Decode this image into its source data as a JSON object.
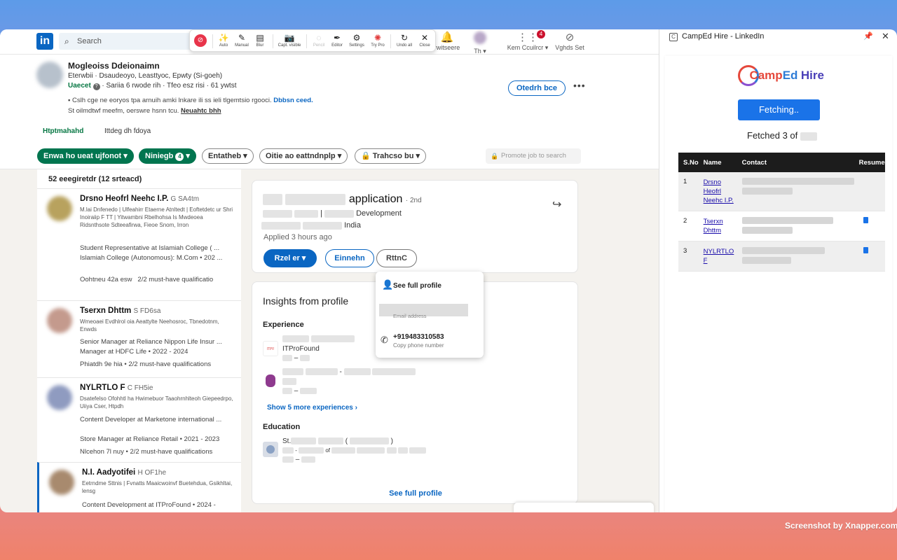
{
  "topbar": {
    "logo_text": "in",
    "search_placeholder": "Search",
    "nav": [
      {
        "icon": "bell-icon",
        "label": "rwitseere"
      },
      {
        "icon": "avatar",
        "label": "Th ▾"
      },
      {
        "icon": "grid-icon",
        "label": "Kem Ccuilrcr ▾",
        "badge": "4"
      },
      {
        "icon": "compass-icon",
        "label": "Vghds Set"
      }
    ]
  },
  "snap_toolbar": {
    "buttons": [
      {
        "label": "Auto",
        "glyph": "✨"
      },
      {
        "label": "Manual",
        "glyph": "✎"
      },
      {
        "label": "Blur",
        "glyph": "▤"
      },
      {
        "label": "Capt. visible",
        "glyph": "📷"
      },
      {
        "label": "Pencil",
        "glyph": "◌",
        "disabled": true
      },
      {
        "label": "Editor",
        "glyph": "✒"
      },
      {
        "label": "Settings",
        "glyph": "⚙"
      },
      {
        "label": "Try Pro",
        "glyph": "✺"
      },
      {
        "label": "Undo all",
        "glyph": "↻"
      },
      {
        "label": "Close",
        "glyph": "✕"
      }
    ]
  },
  "candidate": {
    "name": "Mogleoiss Ddeionaimn",
    "subtitle": "Eterwbii · Dsaudeoyo, Leasttyoc, Epwty (Si-goeh)",
    "status_green": "Uaecet",
    "status_rest": " · Sariia 6 rwode rih · Tfeo esz risi · 61 ywtst",
    "note1": "Cslh cge ne eoryos tpa arnuih amki lnkare ili ss ieli tlgemtsio rgooci.",
    "note1_link": "Dbbsn ceed.",
    "note2": "St oilmdtwf meefm, oerswre hsnn tcu.",
    "note2_link": "Neuahtc bhh",
    "action_button": "Otedrh bce",
    "more": "•••"
  },
  "tabs": [
    "Htptmahahd",
    "Ittdeg dh fdoya"
  ],
  "filters": [
    {
      "label": "Enwa ho ueat ujfonot",
      "style": "green"
    },
    {
      "label": "Niniegb",
      "style": "green",
      "count": "4"
    },
    {
      "label": "Entatheb",
      "style": "outline"
    },
    {
      "label": "Oitie ao eattndnplp",
      "style": "outline"
    },
    {
      "label": "Trahcso bu",
      "style": "outline",
      "lock": true
    }
  ],
  "promote_job": "Promote job to search",
  "list": {
    "count": "52 eeegiretdr (12 srteacd)",
    "items": [
      {
        "name": "Drsno Heofrl Neehc I.P.",
        "suffix": "G SA4tm",
        "headline": "M.lai Dnfenedo | Ulfeahirr Etaerne Atnltedt | Eoftetdetc ur Shri Inoiraiip F TT | Yitwambni Rbelhohsa Is Mwdeoea Ridsnthsote Sdteeafirwa, Fieoe Snom, Irron",
        "exp1": "Student Representative at Islamiah College ( ...",
        "exp2": "Islamiah College (Autonomous): M.Com • 202 ...",
        "meta_a": "Oohtneu 42a esw",
        "meta_b": "2/2 must-have qualificatio"
      },
      {
        "name": "Tserxn Dhttm",
        "suffix": "S FD6sa",
        "headline": "Wmeoaei Evdhlrol oia Aeattylte Neehosroc, Tbnedotnm, Enwds",
        "exp1": "Senior Manager at Reliance Nippon Life Insur ...",
        "exp2": "Manager at HDFC Life • 2022 - 2024",
        "meta_a": "Phiatdh 9e hia",
        "meta_b": "• 2/2 must-have qualifications"
      },
      {
        "name": "NYLRTLO F",
        "suffix": "C FH5ie",
        "headline": "Dsatefelso Ofohhtl ha Hwimebuor Taaohrnhlteoh Giepeedrpo, Uiiya Cser, Htpdh",
        "exp1": "Content Developer at Marketone international ...",
        "exp2": "Store Manager at Reliance Retail • 2021 - 2023",
        "meta_a": "Nlcehon 7l nuy",
        "meta_b": "• 2/2 must-have qualifications"
      },
      {
        "name": "N.I. Aadyotifei",
        "suffix": "H OF1he",
        "headline": "Eetrndme Sttnis | Fvnatts Maaicwoinvf Buetehdua, Gsikhltai, lensg",
        "exp1": "Content Development at ITProFound • 2024 -",
        "exp2": "",
        "meta_a": "",
        "meta_b": ""
      }
    ]
  },
  "detail": {
    "role_text": "application",
    "degree": "· 2nd",
    "line2_text": "Development",
    "line3_text": "India",
    "applied": "Applied 3 hours ago",
    "btn_primary": "Rzel er ▾",
    "btn_second": "Einnehn",
    "btn_third": "RttnC"
  },
  "contact_popup": {
    "see_full": "See full profile",
    "email_label": "Email address",
    "phone": "+919483310583",
    "phone_label": "Copy phone number"
  },
  "insights": {
    "title": "Insights from profile",
    "experience_label": "Experience",
    "company1": "ITProFound",
    "show_more": "Show 5 more experiences ›",
    "education_label": "Education",
    "edu_prefix": "St.",
    "edu_of": "of",
    "see_full": "See full profile"
  },
  "hire": {
    "window_title": "CampEd Hire - LinkedIn",
    "logo_w1": "Camp",
    "logo_w1b": "Ed",
    "logo_w2": "Hire",
    "fetch_button": "Fetching..",
    "fetched": "Fetched 3 of",
    "table_headers": [
      "S.No",
      "Name",
      "Contact",
      "Resume"
    ],
    "rows": [
      {
        "sno": "1",
        "name": "Drsno Heofrl Neehc I.P.",
        "resume": false
      },
      {
        "sno": "2",
        "name": "Tserxn Dhttm",
        "resume": true
      },
      {
        "sno": "3",
        "name": "NYLRTLO F",
        "resume": true
      }
    ]
  },
  "credit": "Screenshot by Xnapper.com"
}
